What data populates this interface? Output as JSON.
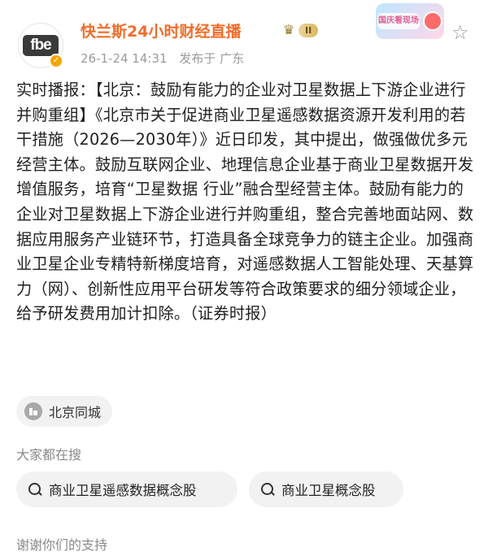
{
  "header": {
    "avatar_logo_text": "fbe",
    "username": "快兰斯24小时财经直播",
    "level_badge": "II",
    "timestamp": "26-1-24 14:31",
    "location_text": "发布于 广东",
    "promo_text": "国庆看现场",
    "star_icon": "star-outline-icon"
  },
  "post": {
    "text": "实时播报：【北京：鼓励有能力的企业对卫星数据上下游企业进行并购重组】《北京市关于促进商业卫星遥感数据资源开发利用的若干措施（2026—2030年）》近日印发，其中提出，做强做优多元经营主体。鼓励互联网企业、地理信息企业基于商业卫星数据开发增值服务，培育“卫星数据 行业”融合型经营主体。鼓励有能力的企业对卫星数据上下游企业进行并购重组，整合完善地面站网、数据应用服务产业链环节，打造具备全球竞争力的链主企业。加强商业卫星企业专精特新梯度培育，对遥感数据人工智能处理、天基算力（网）、创新性应用平台研发等符合政策要求的细分领域企业，给予研发费用加计扣除。（证券时报）"
  },
  "location_chip": {
    "label": "北京同城",
    "icon": "city-building-icon"
  },
  "search": {
    "title": "大家都在搜",
    "items": [
      {
        "label": "商业卫星遥感数据概念股"
      },
      {
        "label": "商业卫星概念股"
      }
    ]
  },
  "footer": {
    "text": "谢谢你们的支持"
  },
  "colors": {
    "username": "#f06d2a",
    "meta": "#9b9b9b",
    "chip_bg": "#f2f2f2"
  }
}
